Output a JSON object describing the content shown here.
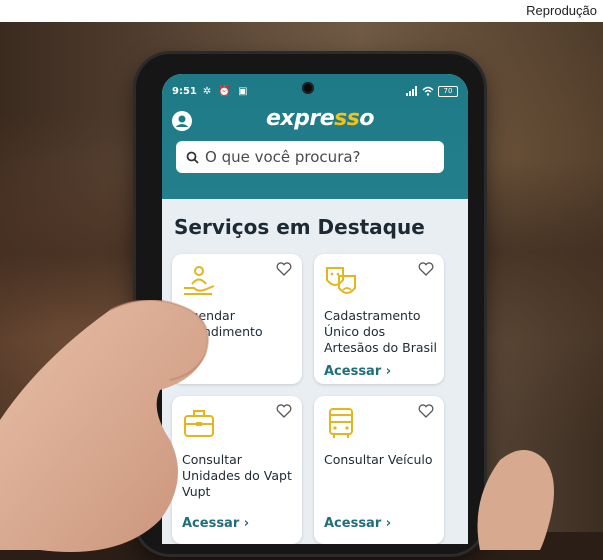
{
  "credit": "Reprodução",
  "status_bar": {
    "time": "9:51",
    "left_icons": "✲ ⏰ ▣",
    "battery": "70"
  },
  "app": {
    "logo_main": "expre",
    "logo_accent": "ss",
    "logo_end": "o",
    "search_placeholder": "O que você procura?",
    "section_title": "Serviços em Destaque"
  },
  "cards": [
    {
      "label": "Agendar Atendimento",
      "action": ""
    },
    {
      "label": "Cadastramento Único dos Artesãos do Brasil",
      "action": "Acessar ›"
    },
    {
      "label": "Consultar Unidades do Vapt Vupt",
      "action": "Acessar ›"
    },
    {
      "label": "Consultar Veículo",
      "action": "Acessar ›"
    }
  ],
  "colors": {
    "header": "#1d7a86",
    "accent_yellow": "#f2c21b",
    "action_text": "#1f6f7a"
  },
  "icons": [
    "profile-icon",
    "search-icon",
    "heart-icon",
    "hand-person-icon",
    "theater-masks-icon",
    "briefcase-icon",
    "bus-icon"
  ]
}
